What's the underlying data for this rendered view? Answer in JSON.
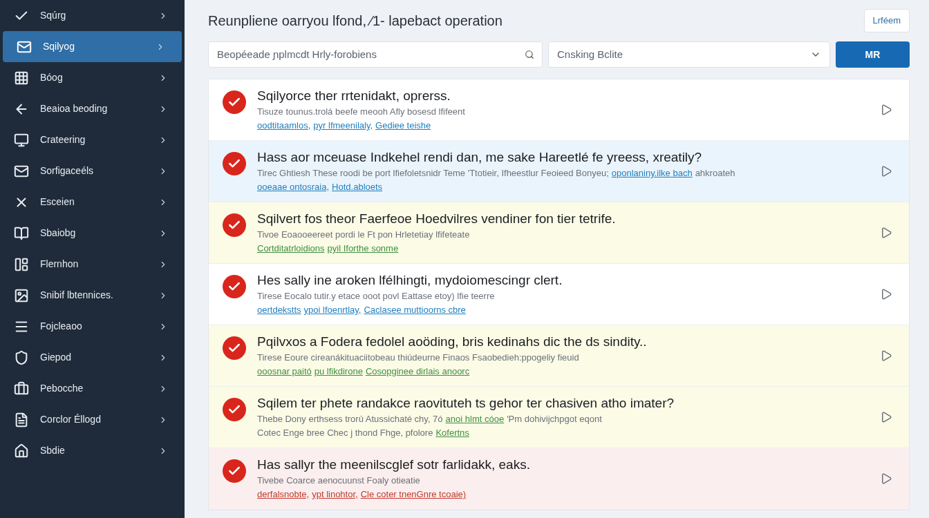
{
  "sidebar": {
    "items": [
      {
        "label": "Sqúrg",
        "selected": false
      },
      {
        "label": "Sqilyog",
        "selected": true
      },
      {
        "label": "Bóog",
        "selected": false
      },
      {
        "label": "Beaioa beoding",
        "selected": false
      },
      {
        "label": "Crateering",
        "selected": false
      },
      {
        "label": "Sorfigaceéls",
        "selected": false
      },
      {
        "label": "Esceien",
        "selected": false
      },
      {
        "label": "Sbaiobg",
        "selected": false
      },
      {
        "label": "Flernhon",
        "selected": false
      },
      {
        "label": "Snibif lbtennices.",
        "selected": false
      },
      {
        "label": "Fojcleaoo",
        "selected": false
      },
      {
        "label": "Giepod",
        "selected": false
      },
      {
        "label": "Pebocche",
        "selected": false
      },
      {
        "label": "Corclor Éllogd",
        "selected": false
      },
      {
        "label": "Sbdie",
        "selected": false
      }
    ]
  },
  "header": {
    "title": "Reunpliene oarryou lfond, ⁄1- lapebact operation",
    "button": "Lrféem"
  },
  "toolbar": {
    "search": {
      "placeholder": "Beopéeade ɲplmcdt Hrly-forobiens"
    },
    "select": {
      "value": "Cnsking Bclite"
    },
    "button": "MR"
  },
  "rows": [
    {
      "kind": "plain",
      "title": "Sqilyorce ther rrtenidakt, oprerss.",
      "lines": [
        [
          {
            "text": "Tisuze tounus.trolá beefe meooh Afly bosesd lfifeent",
            "link": false
          }
        ],
        [
          {
            "text": "oodtitaamlos,",
            "link": true
          },
          {
            "text": "pyr lfmeenilaly,",
            "link": true
          },
          {
            "text": "Gediee teishe",
            "link": true
          }
        ]
      ]
    },
    {
      "kind": "info",
      "title": "Hass aor mceuase Indkehel rendi dan, me sake Hareetlé fe yreess, xreatily?",
      "lines": [
        [
          {
            "text": "Tirec Ghtiesh These roodi be port lfiefoletsnidr Teme 'Ttotieir, Ifheestlur Feoieed Bonyeu;",
            "link": false
          },
          {
            "text": "oponlaniny.ilke bach",
            "link": true
          },
          {
            "text": "ahkroateh",
            "link": false
          }
        ],
        [
          {
            "text": "ooeaae ontosraia,",
            "link": true
          },
          {
            "text": "Hotd.abloets",
            "link": true
          }
        ]
      ]
    },
    {
      "kind": "warning",
      "title": "Sqilvert fos theor Faerfeoe Hoedvilres vendiner fon tier tetrife.",
      "lines": [
        [
          {
            "text": "Tivoe Eoaooeereet pordi le Ft pon Hrletetiay lfifeteate",
            "link": false
          }
        ],
        [
          {
            "text": "Cortditatrloidions",
            "link": true
          },
          {
            "text": "pyil Iforthe sonme",
            "link": true
          }
        ]
      ]
    },
    {
      "kind": "plain",
      "title": "Hes sally ine aroken lfélhingti, mydoiomescingr clert.",
      "lines": [
        [
          {
            "text": "Tirese Eocalo tutir.y etace ooot povl Eattase etoy) lfie teerre",
            "link": false
          }
        ],
        [
          {
            "text": "oertdekstts",
            "link": true
          },
          {
            "text": "ypoi lfoenrtlay,",
            "link": true
          },
          {
            "text": "Caclasee muttioorns cbre",
            "link": true
          }
        ]
      ]
    },
    {
      "kind": "warning",
      "title": "Pqilvxos a Fodera fedolel aoöding, bris kedinahs dic the ds sindity..",
      "lines": [
        [
          {
            "text": "Tirese Eoure cireanákituaciitobeau thiúdeurne Finaos Fsaobedieh:ppogeliy fieuid",
            "link": false
          }
        ],
        [
          {
            "text": "ooosnar paitó",
            "link": true
          },
          {
            "text": "pu lfikdirone",
            "link": true
          },
          {
            "text": "Cosopginee dirlais anoorc",
            "link": true
          }
        ]
      ]
    },
    {
      "kind": "warning",
      "title": "Sqilem ter phete randakce raovituteh ts gehor ter chasiven atho imater?",
      "lines": [
        [
          {
            "text": "Thebe Dony erthsess trorú Atussichaté chy, 7ó",
            "link": false
          },
          {
            "text": "anoi hlmt cóoe",
            "link": true
          },
          {
            "text": "'Pm dohivijchpgot eqont",
            "link": false
          }
        ],
        [
          {
            "text": "Cotec Enge bree Chec j thond Fhge, pfolore",
            "link": false
          },
          {
            "text": "Kofertns",
            "link": true
          }
        ]
      ]
    },
    {
      "kind": "error",
      "title": "Has sallyr the meenilscglef sotr farlidakk, eaks.",
      "lines": [
        [
          {
            "text": "Tivebe Coarce aenocuunst Foaly otieatie",
            "link": false
          }
        ],
        [
          {
            "text": "derfalsnobte,",
            "link": true
          },
          {
            "text": "ypt linohtor,",
            "link": true
          },
          {
            "text": "Cle coter tnenGnre tcoaie)",
            "link": true
          }
        ]
      ]
    }
  ]
}
